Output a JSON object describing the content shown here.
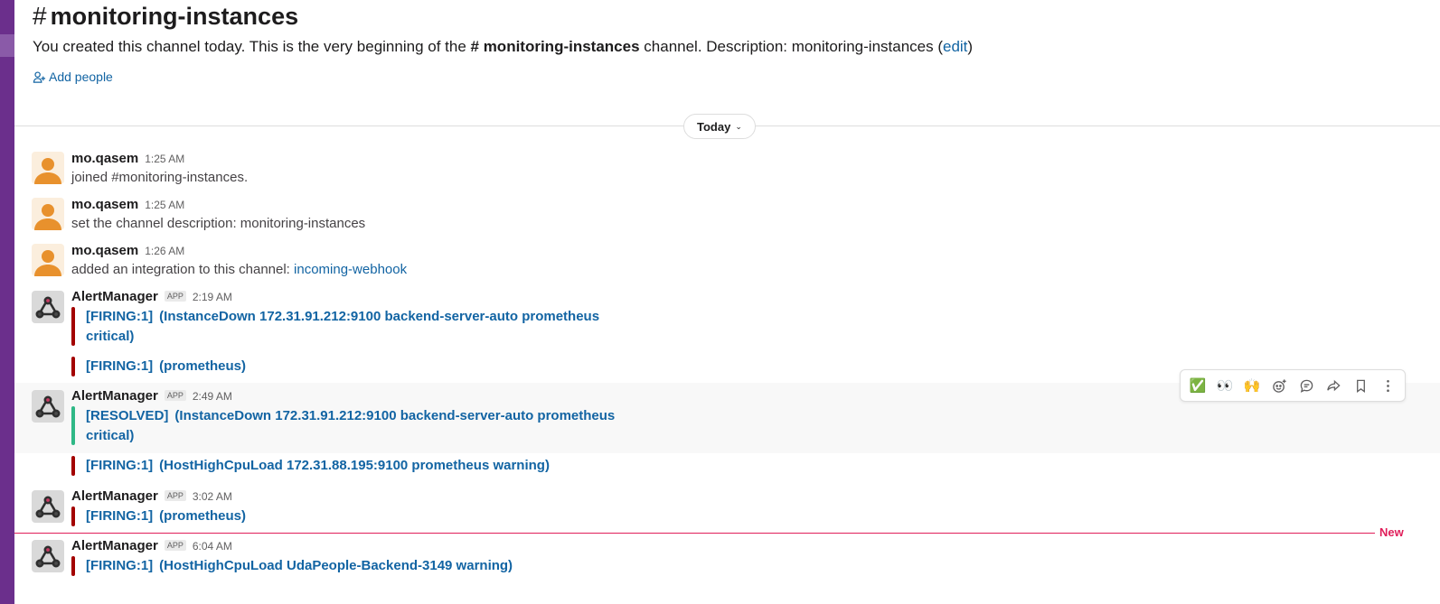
{
  "channel": {
    "hash": "#",
    "name": "monitoring-instances",
    "intro_prefix": "You created this channel today. This is the very beginning of the",
    "intro_channel": "# monitoring-instances",
    "intro_suffix": "channel. Description: monitoring-instances (",
    "intro_edit": "edit",
    "intro_close": ")",
    "add_people": "Add people"
  },
  "day_divider": {
    "label": "Today",
    "chevron": "⌄"
  },
  "app_badge": "APP",
  "messages": [
    {
      "author": "mo.qasem",
      "time": "1:25 AM",
      "text_prefix": "joined #monitoring-instances.",
      "avatar": "user-avatar"
    },
    {
      "author": "mo.qasem",
      "time": "1:25 AM",
      "text_prefix": "set the channel description: monitoring-instances",
      "avatar": "user-avatar"
    },
    {
      "author": "mo.qasem",
      "time": "1:26 AM",
      "text_prefix": "added an integration to this channel:",
      "text_link": "incoming-webhook",
      "avatar": "user-avatar"
    },
    {
      "author": "AlertManager",
      "time": "2:19 AM",
      "avatar": "webhook-avatar",
      "attachments": [
        {
          "status": "[FIRING:1]",
          "line1": "(InstanceDown 172.31.91.212:9100 backend-server-auto prometheus",
          "line2": "critical)",
          "color": "#a30200"
        },
        {
          "status": "[FIRING:1]",
          "line1": "(prometheus)",
          "color": "#a30200"
        }
      ]
    },
    {
      "author": "AlertManager",
      "time": "2:49 AM",
      "avatar": "webhook-avatar",
      "attachments": [
        {
          "status": "[RESOLVED]",
          "line1": "(InstanceDown 172.31.91.212:9100 backend-server-auto prometheus",
          "line2": "critical)",
          "color": "#2eb886"
        },
        {
          "status": "[FIRING:1]",
          "line1": "(HostHighCpuLoad 172.31.88.195:9100 prometheus warning)",
          "color": "#a30200"
        }
      ]
    },
    {
      "author": "AlertManager",
      "time": "3:02 AM",
      "avatar": "webhook-avatar",
      "attachments": [
        {
          "status": "[FIRING:1]",
          "line1": "(prometheus)",
          "color": "#a30200"
        }
      ]
    },
    {
      "author": "AlertManager",
      "time": "6:04 AM",
      "avatar": "webhook-avatar",
      "attachments": [
        {
          "status": "[FIRING:1]",
          "line1": "(HostHighCpuLoad UdaPeople-Backend-3149 warning)",
          "color": "#a30200"
        }
      ]
    }
  ],
  "new_divider": "New",
  "hover_actions": [
    {
      "icon": "check-mark-emoji-icon",
      "glyph": "✅"
    },
    {
      "icon": "eyes-emoji-icon",
      "glyph": "👀"
    },
    {
      "icon": "raised-hands-emoji-icon",
      "glyph": "🙌"
    },
    {
      "icon": "add-reaction-icon"
    },
    {
      "icon": "reply-in-thread-icon"
    },
    {
      "icon": "forward-message-icon"
    },
    {
      "icon": "bookmark-icon"
    },
    {
      "icon": "more-actions-icon"
    }
  ],
  "colors": {
    "firing": "#a30200",
    "resolved": "#2eb886",
    "link": "#1264a3",
    "new": "#e01e5a",
    "sidebar": "#6b2f8c"
  }
}
